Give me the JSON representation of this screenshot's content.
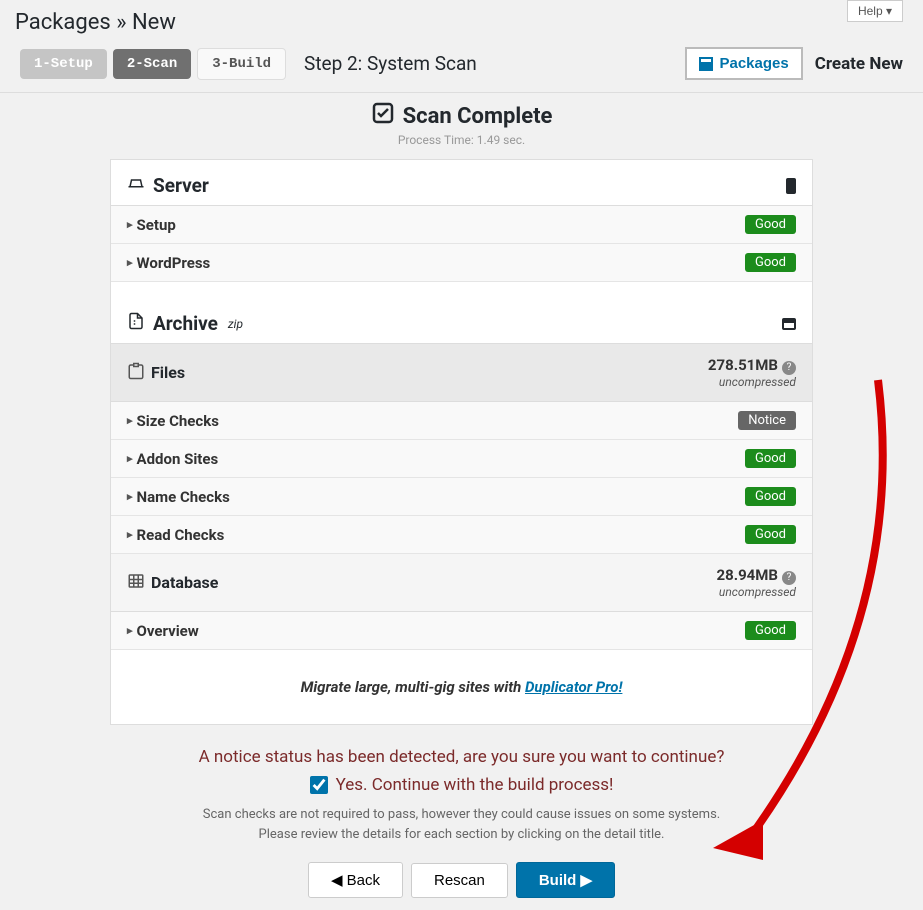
{
  "help_label": "Help",
  "breadcrumb": "Packages » New",
  "wizard": {
    "step1": "1-Setup",
    "step2": "2-Scan",
    "step3": "3-Build",
    "title": "Step 2: System Scan"
  },
  "packages_btn": "Packages",
  "create_new": "Create New",
  "scan": {
    "title": "Scan Complete",
    "process_time": "Process Time: 1.49 sec."
  },
  "server": {
    "title": "Server",
    "rows": {
      "setup": {
        "label": "Setup",
        "badge": "Good"
      },
      "wordpress": {
        "label": "WordPress",
        "badge": "Good"
      }
    }
  },
  "archive": {
    "title": "Archive",
    "suffix": "zip",
    "files": {
      "title": "Files",
      "size": "278.51MB",
      "size_label": "uncompressed",
      "rows": {
        "size_checks": {
          "label": "Size Checks",
          "badge": "Notice"
        },
        "addon_sites": {
          "label": "Addon Sites",
          "badge": "Good"
        },
        "name_checks": {
          "label": "Name Checks",
          "badge": "Good"
        },
        "read_checks": {
          "label": "Read Checks",
          "badge": "Good"
        }
      }
    },
    "database": {
      "title": "Database",
      "size": "28.94MB",
      "size_label": "uncompressed",
      "rows": {
        "overview": {
          "label": "Overview",
          "badge": "Good"
        }
      }
    }
  },
  "migrate": {
    "text": "Migrate large, multi-gig sites with ",
    "link": "Duplicator Pro!"
  },
  "notice": {
    "text": "A notice status has been detected, are you sure you want to continue?",
    "confirm": "Yes. Continue with the build process!",
    "hint1": "Scan checks are not required to pass, however they could cause issues on some systems.",
    "hint2": "Please review the details for each section by clicking on the detail title."
  },
  "buttons": {
    "back": "Back",
    "rescan": "Rescan",
    "build": "Build"
  }
}
